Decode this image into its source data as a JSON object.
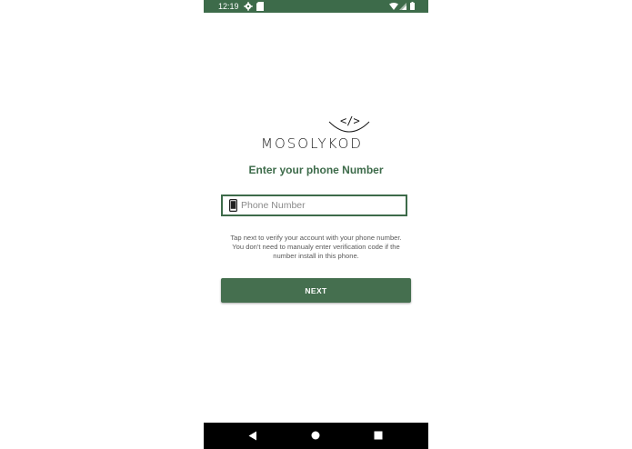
{
  "status_bar": {
    "time": "12:19",
    "icons": [
      "gear-icon",
      "sdcard-icon",
      "wifi-icon",
      "signal-icon",
      "battery-icon"
    ],
    "background_color": "#3d6b4a"
  },
  "logo": {
    "wordmark": "MOSOLYKOD",
    "code_symbol": "</>"
  },
  "screen": {
    "title": "Enter your phone Number",
    "phone_input": {
      "value": "",
      "placeholder": "Phone Number",
      "icon": "smartphone-icon"
    },
    "help_text": "Tap next to verify your account with your phone number. You don't need to manualy enter verification code if the number install in this phone.",
    "next_label": "NEXT"
  },
  "colors": {
    "accent": "#3d6b4a",
    "button": "#456f4f",
    "text_secondary": "#5a5a5a"
  },
  "nav_bar": {
    "icons": [
      "back-icon",
      "home-icon",
      "recents-icon"
    ]
  }
}
